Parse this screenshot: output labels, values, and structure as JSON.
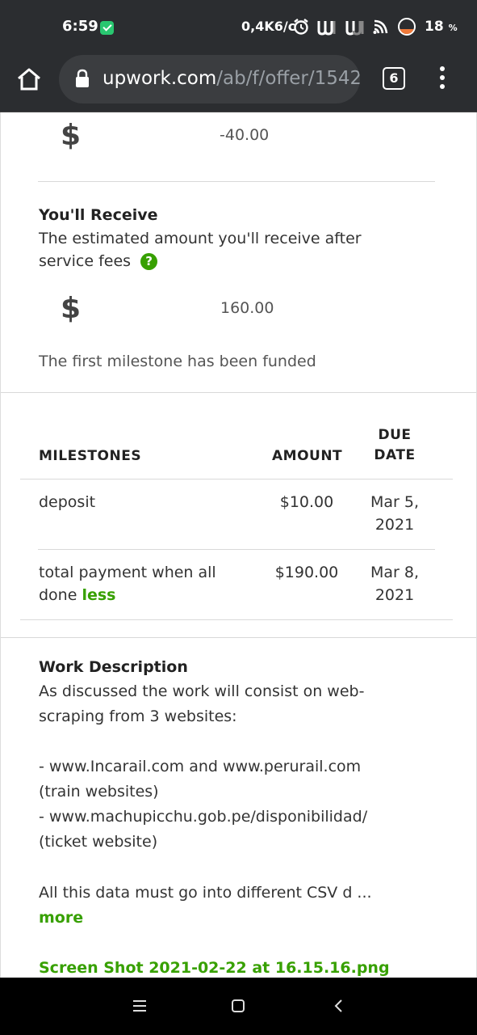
{
  "status_bar": {
    "time": "6:59",
    "network_speed": "0,4K6/c",
    "battery": "18",
    "battery_unit": "%"
  },
  "browser": {
    "url_host": "upwork.com",
    "url_path": "/ab/f/offer/1542",
    "tab_count": "6"
  },
  "fees": {
    "currency_symbol": "$",
    "service_fee_amount": "-40.00"
  },
  "receive": {
    "heading": "You'll Receive",
    "description": "The estimated amount you'll receive after service fees",
    "help_icon": "?",
    "currency_symbol": "$",
    "amount": "160.00",
    "funded_note": "The first milestone has been funded"
  },
  "milestones": {
    "headers": {
      "milestones": "MILESTONES",
      "amount": "AMOUNT",
      "due_date_line1": "DUE",
      "due_date_line2": "DATE"
    },
    "rows": [
      {
        "name": "deposit",
        "amount": "$10.00",
        "due_line1": "Mar 5,",
        "due_line2": "2021"
      },
      {
        "name_line1": "total payment when all",
        "name_line2": "done",
        "toggle": "less",
        "amount": "$190.00",
        "due_line1": "Mar 8,",
        "due_line2": "2021"
      }
    ]
  },
  "work": {
    "heading": "Work Description",
    "line1": "As discussed the work will consist on web-",
    "line2": "scraping from 3 websites:",
    "line3": "- www.Incarail.com and www.perurail.com",
    "line4": "(train websites)",
    "line5": "- www.machupicchu.gob.pe/disponibilidad/",
    "line6": "(ticket website)",
    "line7": "All this data must go into different CSV d ...",
    "more": "more",
    "attachment": "Screen Shot 2021-02-22 at 16.15.16.png"
  },
  "icons": {
    "home": "home-icon",
    "lock": "lock-icon",
    "menu": "more-vert-icon",
    "recents": "recents-icon",
    "home_nav": "home-square-icon",
    "back": "back-icon"
  }
}
